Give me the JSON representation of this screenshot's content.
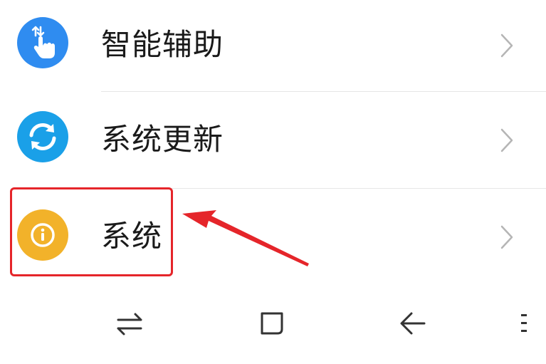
{
  "settings_list": {
    "items": [
      {
        "label": "智能辅助",
        "icon": "hand-touch-icon",
        "color": "#2f8cf0"
      },
      {
        "label": "系统更新",
        "icon": "refresh-icon",
        "color": "#1aa0e8"
      },
      {
        "label": "系统",
        "icon": "info-icon",
        "color": "#f2b22a"
      }
    ]
  },
  "annotation": {
    "highlight_color": "#e5252a"
  },
  "navbar": {
    "buttons": [
      "switch-icon",
      "square-home-icon",
      "back-arrow-icon",
      "menu-dots-icon"
    ]
  }
}
